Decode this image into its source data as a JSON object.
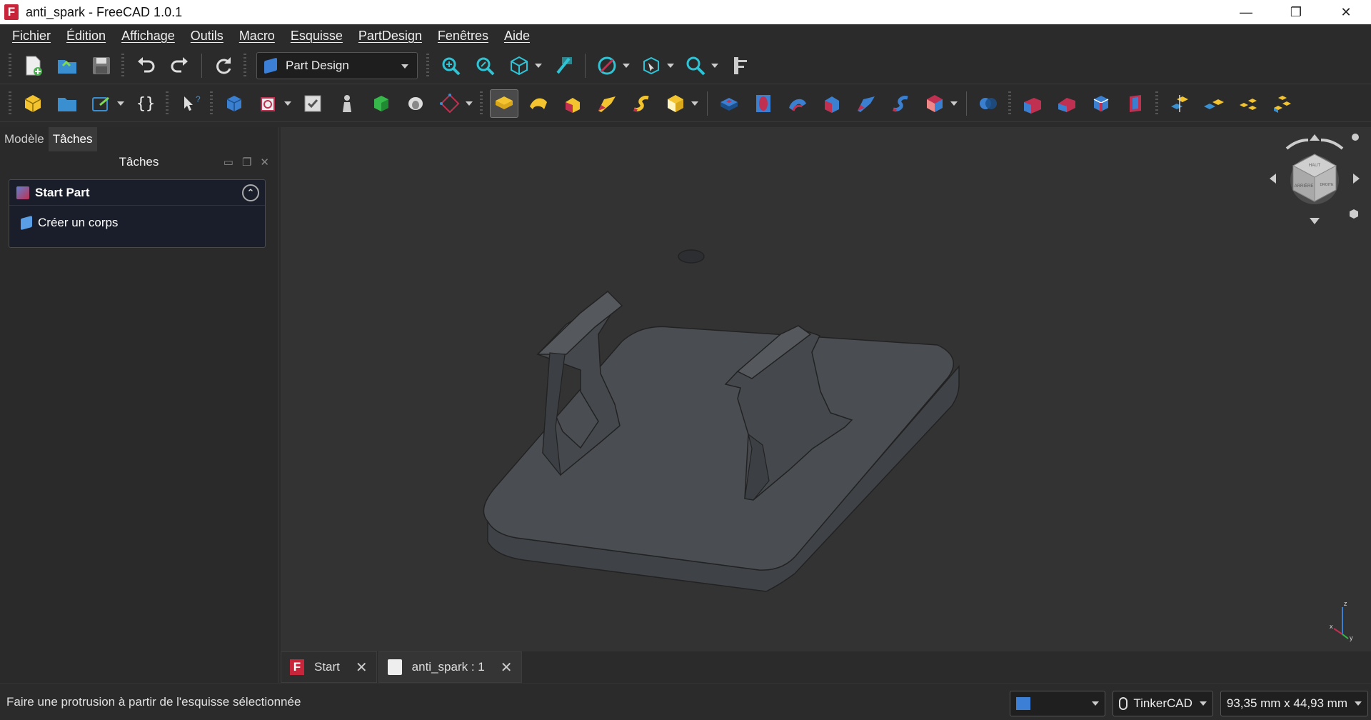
{
  "window": {
    "title": "anti_spark - FreeCAD 1.0.1",
    "app_icon_letter": "F",
    "minimize": "—",
    "restore": "❐",
    "close": "✕"
  },
  "menu": [
    "Fichier",
    "Édition",
    "Affichage",
    "Outils",
    "Macro",
    "Esquisse",
    "PartDesign",
    "Fenêtres",
    "Aide"
  ],
  "toolbar": {
    "workbench": "Part Design"
  },
  "left_panel": {
    "tabs": [
      "Modèle",
      "Tâches"
    ],
    "active_tab": "Tâches",
    "header": "Tâches",
    "task_box_title": "Start Part",
    "task_action": "Créer un corps"
  },
  "doc_tabs": [
    {
      "label": "Start",
      "close": "✕"
    },
    {
      "label": "anti_spark : 1",
      "close": "✕"
    }
  ],
  "axis": {
    "z": "z",
    "x": "x",
    "y": "y"
  },
  "navcube": {
    "face_top": "HAUT",
    "face_front": "ARRIÈRE",
    "face_side": "DROITE"
  },
  "statusbar": {
    "message": "Faire une protrusion à partir de l'esquisse sélectionnée",
    "navigation_style": "TinkerCAD",
    "dimensions": "93,35 mm x 44,93 mm"
  },
  "colors": {
    "background": "#2b2b2b",
    "viewport": "#333333",
    "model": "#4a4d52",
    "accent": "#3b7fd6"
  }
}
